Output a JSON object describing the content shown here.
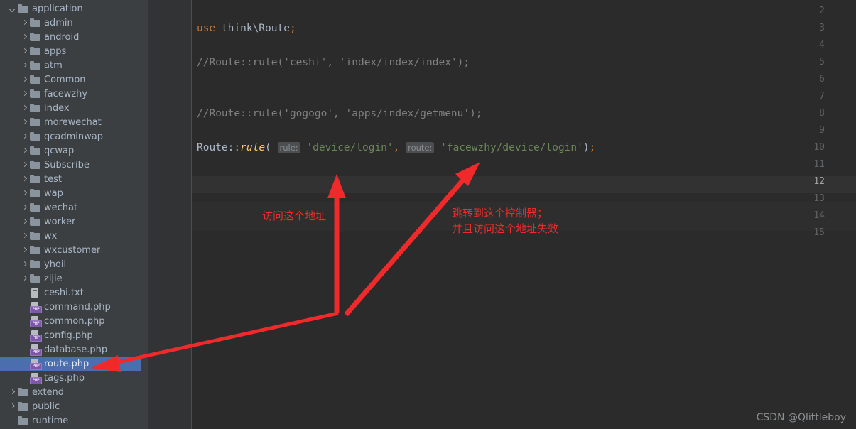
{
  "sidebar": {
    "scrollbar": {
      "name": "sidebar-vertical-scrollbar"
    },
    "items": [
      {
        "label": "application",
        "indent": 0,
        "icon": "folder",
        "chevron": "open",
        "selected": false
      },
      {
        "label": "admin",
        "indent": 1,
        "icon": "folder",
        "chevron": "closed",
        "selected": false
      },
      {
        "label": "android",
        "indent": 1,
        "icon": "folder",
        "chevron": "closed",
        "selected": false
      },
      {
        "label": "apps",
        "indent": 1,
        "icon": "folder",
        "chevron": "closed",
        "selected": false
      },
      {
        "label": "atm",
        "indent": 1,
        "icon": "folder",
        "chevron": "closed",
        "selected": false
      },
      {
        "label": "Common",
        "indent": 1,
        "icon": "folder",
        "chevron": "closed",
        "selected": false
      },
      {
        "label": "facewzhy",
        "indent": 1,
        "icon": "folder",
        "chevron": "closed",
        "selected": false
      },
      {
        "label": "index",
        "indent": 1,
        "icon": "folder",
        "chevron": "closed",
        "selected": false
      },
      {
        "label": "morewechat",
        "indent": 1,
        "icon": "folder",
        "chevron": "closed",
        "selected": false
      },
      {
        "label": "qcadminwap",
        "indent": 1,
        "icon": "folder",
        "chevron": "closed",
        "selected": false
      },
      {
        "label": "qcwap",
        "indent": 1,
        "icon": "folder",
        "chevron": "closed",
        "selected": false
      },
      {
        "label": "Subscribe",
        "indent": 1,
        "icon": "folder",
        "chevron": "closed",
        "selected": false
      },
      {
        "label": "test",
        "indent": 1,
        "icon": "folder",
        "chevron": "closed",
        "selected": false
      },
      {
        "label": "wap",
        "indent": 1,
        "icon": "folder",
        "chevron": "closed",
        "selected": false
      },
      {
        "label": "wechat",
        "indent": 1,
        "icon": "folder",
        "chevron": "closed",
        "selected": false
      },
      {
        "label": "worker",
        "indent": 1,
        "icon": "folder",
        "chevron": "closed",
        "selected": false
      },
      {
        "label": "wx",
        "indent": 1,
        "icon": "folder",
        "chevron": "closed",
        "selected": false
      },
      {
        "label": "wxcustomer",
        "indent": 1,
        "icon": "folder",
        "chevron": "closed",
        "selected": false
      },
      {
        "label": "yhoil",
        "indent": 1,
        "icon": "folder",
        "chevron": "closed",
        "selected": false
      },
      {
        "label": "zijie",
        "indent": 1,
        "icon": "folder",
        "chevron": "closed",
        "selected": false
      },
      {
        "label": "ceshi.txt",
        "indent": 1,
        "icon": "txt",
        "chevron": "none",
        "selected": false
      },
      {
        "label": "command.php",
        "indent": 1,
        "icon": "php",
        "chevron": "none",
        "selected": false
      },
      {
        "label": "common.php",
        "indent": 1,
        "icon": "php",
        "chevron": "none",
        "selected": false
      },
      {
        "label": "config.php",
        "indent": 1,
        "icon": "php",
        "chevron": "none",
        "selected": false
      },
      {
        "label": "database.php",
        "indent": 1,
        "icon": "php",
        "chevron": "none",
        "selected": false
      },
      {
        "label": "route.php",
        "indent": 1,
        "icon": "php",
        "chevron": "none",
        "selected": true
      },
      {
        "label": "tags.php",
        "indent": 1,
        "icon": "php",
        "chevron": "none",
        "selected": false
      },
      {
        "label": "extend",
        "indent": 0,
        "icon": "folder",
        "chevron": "closed",
        "selected": false
      },
      {
        "label": "public",
        "indent": 0,
        "icon": "folder",
        "chevron": "closed",
        "selected": false
      },
      {
        "label": "runtime",
        "indent": 0,
        "icon": "folder",
        "chevron": "none",
        "selected": false
      }
    ],
    "php_badge_text": "PHP"
  },
  "editor": {
    "caret_line": 12,
    "line_numbers": [
      "2",
      "3",
      "4",
      "5",
      "6",
      "7",
      "8",
      "9",
      "10",
      "11",
      "12",
      "13",
      "14",
      "15"
    ],
    "lines": [
      {
        "num": 3,
        "tokens": [
          {
            "text": "use ",
            "cls": "kw"
          },
          {
            "text": "think\\Route",
            "cls": "plain"
          },
          {
            "text": ";",
            "cls": "semi"
          }
        ]
      },
      {
        "num": 5,
        "tokens": [
          {
            "text": "//Route::rule('ceshi', 'index/index/index');",
            "cls": "cmt"
          }
        ]
      },
      {
        "num": 8,
        "tokens": [
          {
            "text": "//Route::rule('gogogo', 'apps/index/getmenu');",
            "cls": "cmt"
          }
        ]
      },
      {
        "num": 10,
        "tokens": [
          {
            "text": "Route",
            "cls": "cls"
          },
          {
            "text": "::",
            "cls": "punc"
          },
          {
            "text": "rule",
            "cls": "mth"
          },
          {
            "text": "(",
            "cls": "punc"
          },
          {
            "text": " ",
            "cls": "plain"
          },
          {
            "text": "rule:",
            "cls": "hint"
          },
          {
            "text": " ",
            "cls": "plain"
          },
          {
            "text": "'device/login'",
            "cls": "str"
          },
          {
            "text": ",",
            "cls": "semi"
          },
          {
            "text": " ",
            "cls": "plain"
          },
          {
            "text": "route:",
            "cls": "hint"
          },
          {
            "text": " ",
            "cls": "plain"
          },
          {
            "text": "'facewzhy/device/login'",
            "cls": "str"
          },
          {
            "text": ")",
            "cls": "punc"
          },
          {
            "text": ";",
            "cls": "semi"
          }
        ]
      }
    ]
  },
  "annotations": {
    "color": "#f02a2a",
    "left_label": "访问这个地址",
    "right_label_line1": "跳转到这个控制器；",
    "right_label_line2": "并且访问这个地址失效"
  },
  "watermark": {
    "text": "CSDN @Qlittleboy"
  }
}
